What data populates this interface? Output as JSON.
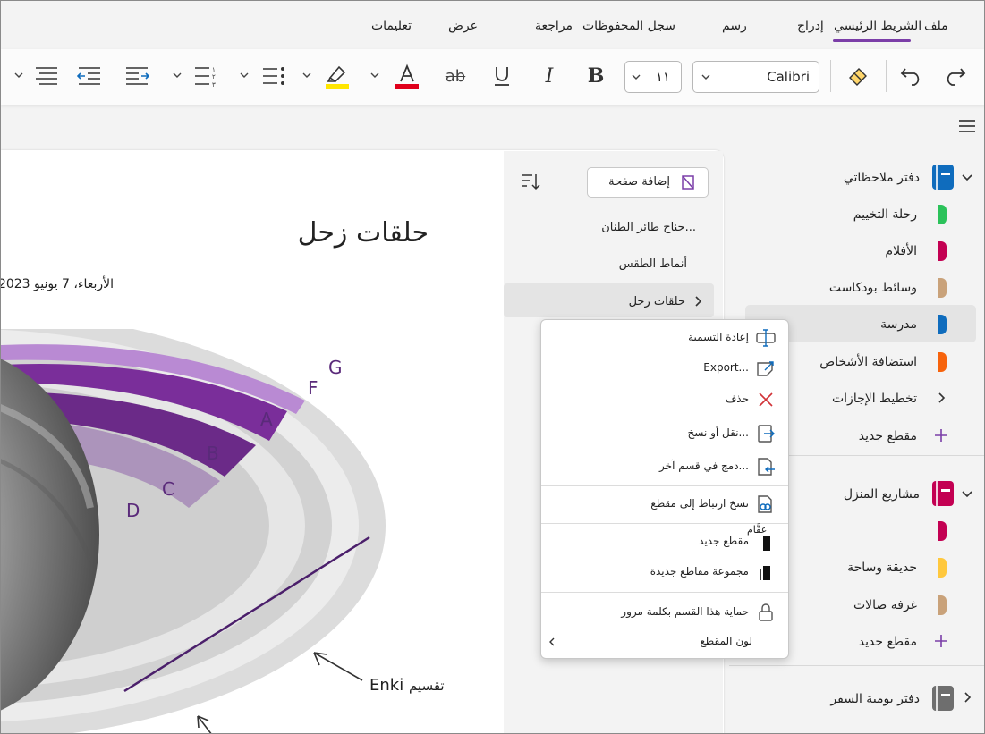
{
  "menu": {
    "tabs": [
      "ملف",
      "الشريط الرئيسي",
      "إدراج",
      "رسم",
      "سجل المحفوظات",
      "مراجعة",
      "عرض",
      "تعليمات"
    ],
    "active_tab": "الشريط الرئيسي"
  },
  "ribbon": {
    "font_name": "Calibri",
    "font_size": "١١",
    "accent": "#7b3ea8",
    "font_color": "#e0001b",
    "highlight_color": "#ffe600"
  },
  "notebooks": [
    {
      "name": "دفتر ملاحظاتي",
      "color": "#0f6cbd",
      "sections": [
        {
          "label": "رحلة التخييم",
          "color": "#2bc25a"
        },
        {
          "label": "الأفلام",
          "color": "#c30052"
        },
        {
          "label": "وسائط بودكاست",
          "color": "#c9a27a"
        },
        {
          "label": "مدرسة",
          "color": "#0f6cbd"
        },
        {
          "label": "استضافة الأشخاص",
          "color": "#f7630c"
        },
        {
          "label": "تخطيط الإجازات",
          "color": ""
        }
      ],
      "new_section": "مقطع جديد"
    },
    {
      "name": "مشاريع المنزل",
      "color": "#c30052",
      "sections": [
        {
          "label": "",
          "color": "#c30052"
        },
        {
          "label": "حديقة وساحة",
          "color": "#ffc83d"
        },
        {
          "label": "غرفة صالات",
          "color": "#c9a27a"
        }
      ],
      "new_section": "مقطع جديد"
    },
    {
      "name": "دفتر يومية السفر",
      "color": "#6e6e6e",
      "sections": []
    }
  ],
  "pages": {
    "add_page": "إضافة صفحة",
    "items": [
      "جناح طائر الطنان...",
      "أنماط الطقس",
      "حلقات زحل"
    ]
  },
  "page": {
    "title": "حلقات زحل",
    "date": "الأربعاء، 7 يونيو 2023",
    "annotation_labels": [
      "A",
      "B",
      "F",
      "G",
      "D",
      "C"
    ],
    "caption_en": "Enki",
    "caption_ar": "تقسيم"
  },
  "context_menu": {
    "items": [
      {
        "label": "إعادة التسمية",
        "icon": "rename-icon"
      },
      {
        "label": "Export...",
        "icon": "export-icon"
      },
      {
        "label": "حذف",
        "icon": "delete-icon"
      },
      {
        "label": "نقل أو نسخ...",
        "icon": "move-copy-icon"
      },
      {
        "label": "دمج في قسم آخر...",
        "icon": "merge-icon"
      },
      {
        "label": "نسخ ارتباط إلى مقطع",
        "icon": "copy-link-icon"
      },
      {
        "label": "مقطع جديد",
        "icon": "new-section-icon"
      },
      {
        "label": "مجموعة مقاطع جديدة",
        "icon": "new-section-group-icon"
      },
      {
        "label": "حماية هذا القسم بكلمة مرور",
        "icon": "lock-icon"
      },
      {
        "label": "لون المقطع",
        "icon": "chevron-left-icon"
      }
    ],
    "overlay_label": "عقَّام"
  }
}
